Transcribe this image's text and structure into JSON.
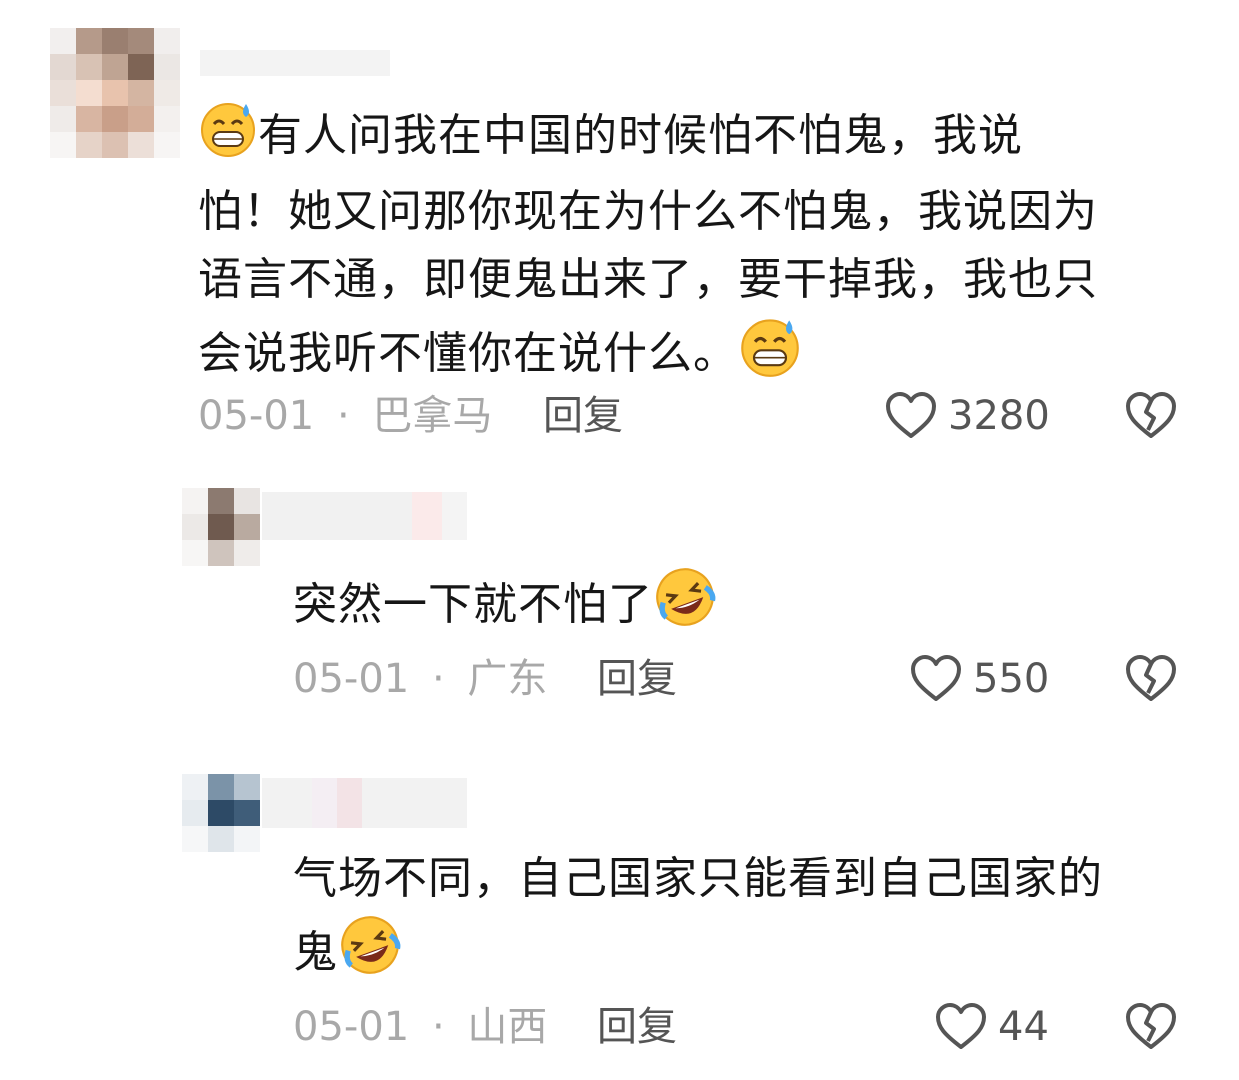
{
  "comments": [
    {
      "text_lines": [
        "有人问我在中国的时候怕不怕鬼，我说",
        "怕！她又问那你现在为什么不怕鬼，我说因为",
        "语言不通，即便鬼出来了，要干掉我，我也只",
        "会说我听不懂你在说什么。"
      ],
      "date": "05-01",
      "sep": "·",
      "location": "巴拿马",
      "reply_label": "回复",
      "likes": "3280",
      "lead_emoji": "grinning-sweat-emoji",
      "trail_emoji": "grinning-sweat-emoji"
    },
    {
      "text_lines": [
        "突然一下就不怕了"
      ],
      "date": "05-01",
      "sep": "·",
      "location": "广东",
      "reply_label": "回复",
      "likes": "550",
      "trail_emoji": "rofl-emoji"
    },
    {
      "text_lines": [
        "气场不同，自己国家只能看到自己国家的",
        "鬼"
      ],
      "date": "05-01",
      "sep": "·",
      "location": "山西",
      "reply_label": "回复",
      "likes": "44",
      "trail_emoji": "rofl-emoji"
    }
  ],
  "icons": {
    "like": "heart-outline-icon",
    "dislike": "broken-heart-icon"
  },
  "colors": {
    "text": "#161616",
    "meta": "#a8a8a8",
    "reply": "#555555",
    "icon": "#555555"
  }
}
